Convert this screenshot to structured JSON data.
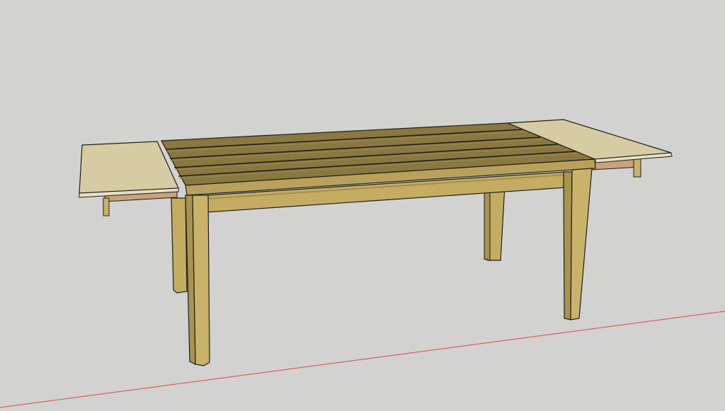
{
  "viewport": {
    "background": "#d2d2d0",
    "axis_red_color": "#d84a4a",
    "edge_color": "#1e1e1e"
  },
  "model": {
    "name_icon": "table-model-icon",
    "colors": {
      "top_plank": "#8a7840",
      "top_plank_light": "#9a8a52",
      "apron_front": "#c4ad62",
      "apron_shadow": "#a58e4a",
      "leg_front": "#c9b36a",
      "leg_side": "#a9934f",
      "leaf_top": "#d6cba2",
      "leaf_edge": "#e7dfbf",
      "runner": "#c9a27a"
    }
  }
}
